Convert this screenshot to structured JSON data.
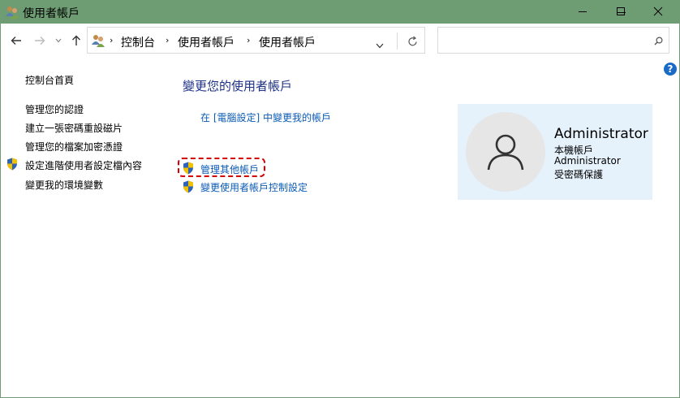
{
  "window": {
    "title": "使用者帳戶",
    "minimize_icon": "minimize-icon",
    "maximize_icon": "maximize-icon",
    "close_icon": "close-icon"
  },
  "address": {
    "breadcrumbs": [
      "控制台",
      "使用者帳戶",
      "使用者帳戶"
    ],
    "search_placeholder": ""
  },
  "sidebar": {
    "home": "控制台首頁",
    "items": [
      {
        "label": "管理您的認證",
        "shield": false
      },
      {
        "label": "建立一張密碼重設磁片",
        "shield": false
      },
      {
        "label": "管理您的檔案加密憑證",
        "shield": false
      },
      {
        "label": "設定進階使用者設定檔內容",
        "shield": true
      },
      {
        "label": "變更我的環境變數",
        "shield": false
      }
    ]
  },
  "main": {
    "heading": "變更您的使用者帳戶",
    "pc_settings_link": "在 [電腦設定] 中變更我的帳戶",
    "manage_other_link": "管理其他帳戶",
    "uac_link": "變更使用者帳戶控制設定"
  },
  "user": {
    "name": "Administrator",
    "account_type": "本機帳戶",
    "group": "Administrator",
    "password_status": "受密碼保護"
  },
  "colors": {
    "titlebar": "#6f9d73",
    "link": "#0b5bb5",
    "heading": "#1e3287",
    "card": "#e5f1fb",
    "highlight": "#d40000"
  }
}
